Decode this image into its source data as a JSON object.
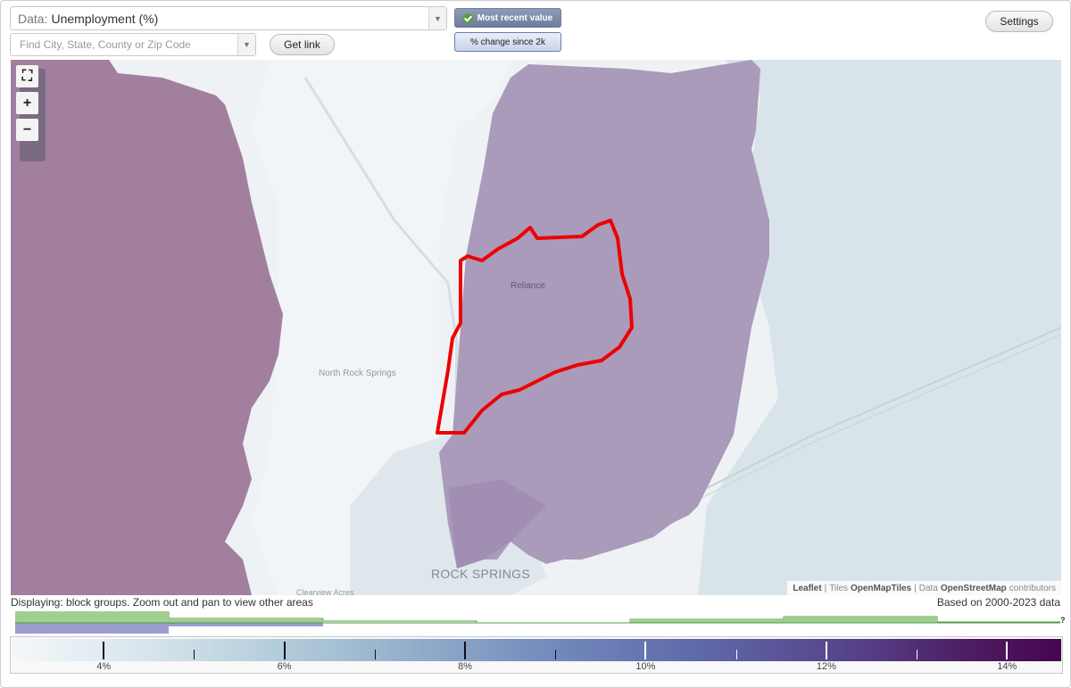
{
  "controls": {
    "data_prefix": "Data:",
    "data_value": "Unemployment (%)",
    "search_placeholder": "Find City, State, County or Zip Code",
    "get_link_label": "Get link",
    "most_recent_label": "Most recent value",
    "pct_change_label": "% change since 2k",
    "settings_label": "Settings"
  },
  "map": {
    "places": {
      "reliance": "Reliance",
      "north_rock_springs": "North Rock Springs",
      "rock_springs": "ROCK SPRINGS",
      "clearview_acres": "Clearview Acres"
    },
    "attribution": {
      "leaflet": "Leaflet",
      "sep1": "|",
      "tiles_prefix": "Tiles",
      "tiles_name": "OpenMapTiles",
      "sep2": "|",
      "data_prefix": "Data",
      "data_name": "OpenStreetMap",
      "data_suffix": "contributors"
    },
    "colors": {
      "west_region": "#a27f9f",
      "east_region": "#aa9bba",
      "selection_outline": "#ee0000",
      "water_area": "#d9e4ea"
    },
    "zoom_icons": [
      "fullscreen-icon",
      "plus-icon",
      "minus-icon"
    ]
  },
  "footer": {
    "displaying_text": "Displaying: block groups. Zoom out and pan to view other areas",
    "based_on_text": "Based on 2000-2023 data",
    "histogram_unknown": "?"
  },
  "legend": {
    "min": 3,
    "max": 14.6,
    "ticks": [
      {
        "label": "4%",
        "value": 4
      },
      {
        "label": "6%",
        "value": 6
      },
      {
        "label": "8%",
        "value": 8
      },
      {
        "label": "10%",
        "value": 10
      },
      {
        "label": "12%",
        "value": 12
      },
      {
        "label": "14%",
        "value": 14
      }
    ],
    "minor_ticks": [
      5,
      7,
      9,
      11,
      13
    ]
  }
}
